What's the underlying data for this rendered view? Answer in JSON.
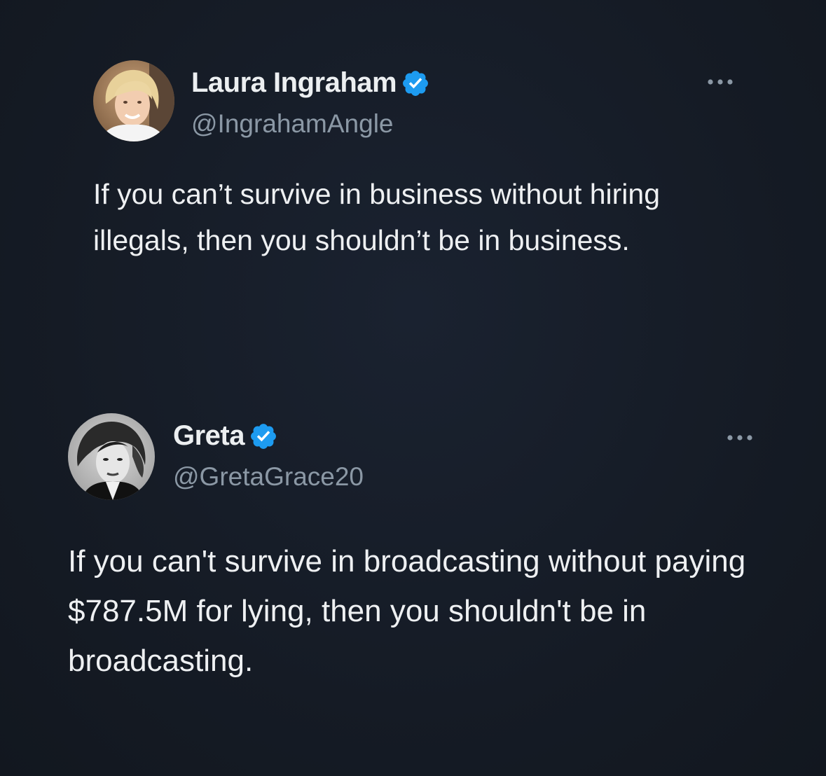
{
  "tweets": [
    {
      "display_name": "Laura Ingraham",
      "handle": "@IngrahamAngle",
      "text": "If you can’t survive in business without hiring illegals, then you shouldn’t be in business.",
      "verified": true,
      "avatar": "profile-photo-blonde-woman"
    },
    {
      "display_name": "Greta",
      "handle": "@GretaGrace20",
      "text": "If you can't survive in broadcasting without paying $787.5M for lying, then you shouldn't be in broadcasting.",
      "verified": true,
      "avatar": "profile-photo-black-and-white-portrait"
    }
  ],
  "colors": {
    "background": "#161c26",
    "text": "#e7e9ea",
    "secondary_text": "#8b98a5",
    "verified_badge": "#1d9bf0"
  },
  "icons": {
    "verified": "verified-badge-icon",
    "more": "more-options-icon"
  }
}
